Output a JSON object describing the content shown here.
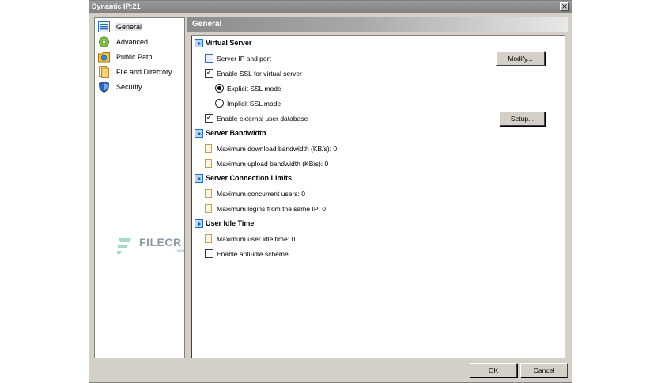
{
  "window": {
    "title": "Dynamic IP:21",
    "close_glyph": "×"
  },
  "sidebar": {
    "items": [
      {
        "label": "General",
        "icon": "general-icon",
        "active": true
      },
      {
        "label": "Advanced",
        "icon": "gear-icon",
        "active": false
      },
      {
        "label": "Public Path",
        "icon": "folder-icon",
        "active": false
      },
      {
        "label": "File and Directory",
        "icon": "file-icon",
        "active": false
      },
      {
        "label": "Security",
        "icon": "shield-icon",
        "active": false
      }
    ]
  },
  "content": {
    "header": "General",
    "groups": {
      "virtual_server": {
        "title": "Virtual Server",
        "server_ip": "Server IP and port",
        "enable_ssl": "Enable SSL for virtual server",
        "explicit_ssl": "Explicit SSL mode",
        "implicit_ssl": "Implicit SSL mode",
        "external_db": "Enable external user database",
        "modify_button": "Modify...",
        "setup_button": "Setup...",
        "enable_ssl_checked": true,
        "explicit_selected": true,
        "external_db_checked": true
      },
      "bandwidth": {
        "title": "Server Bandwidth",
        "download": "Maximum download bandwidth (KB/s): 0",
        "upload": "Maximum upload bandwidth (KB/s): 0"
      },
      "connection_limits": {
        "title": "Server Connection Limits",
        "concurrent": "Maximum concurrent users: 0",
        "same_ip": "Maximum logins from the same IP: 0"
      },
      "idle": {
        "title": "User Idle Time",
        "idle_time": "Maximum user idle time: 0",
        "anti_idle": "Enable anti-idle scheme",
        "anti_idle_checked": false
      }
    }
  },
  "footer": {
    "ok_label": "OK",
    "cancel_label": "Cancel"
  },
  "watermark": {
    "text": "FILECR",
    "suffix": ".com"
  },
  "colors": {
    "accent": "#2a6fb8",
    "header_gradient_start": "#8c8c8c",
    "dialog_bg": "#d4d0c8"
  }
}
